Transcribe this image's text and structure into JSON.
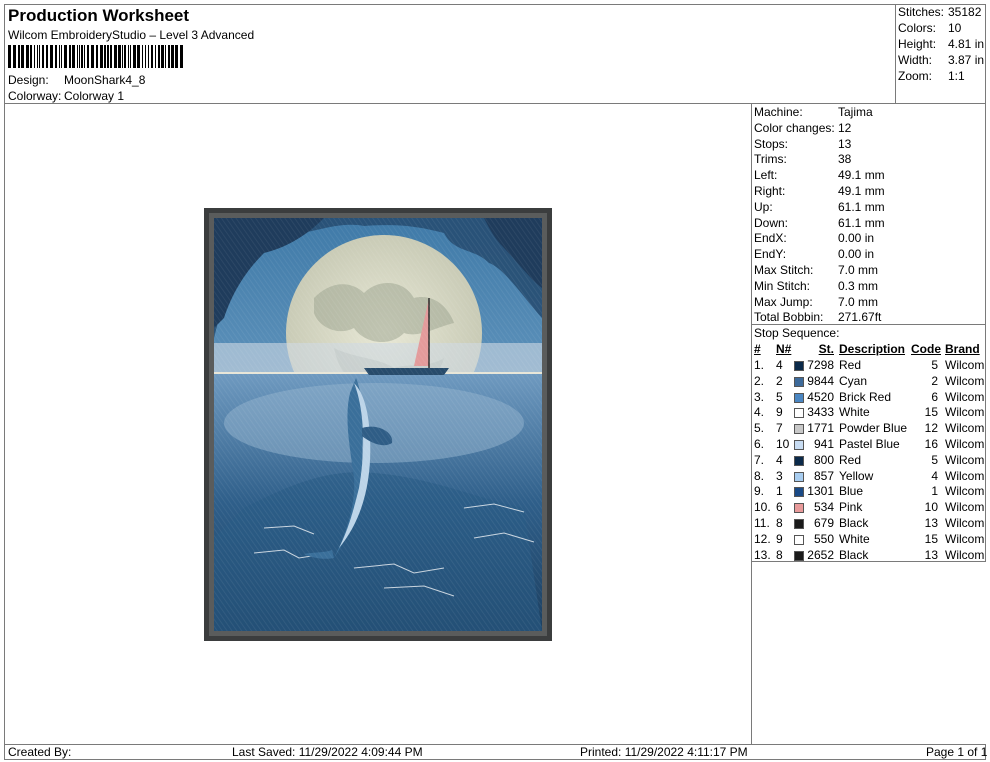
{
  "header": {
    "title": "Production Worksheet",
    "subtitle": "Wilcom EmbroideryStudio – Level 3 Advanced",
    "design_label": "Design:",
    "design_value": "MoonShark4_8",
    "colorway_label": "Colorway:",
    "colorway_value": "Colorway 1"
  },
  "summary": [
    {
      "label": "Stitches:",
      "value": "35182"
    },
    {
      "label": "Colors:",
      "value": "10"
    },
    {
      "label": "Height:",
      "value": "4.81 in"
    },
    {
      "label": "Width:",
      "value": "3.87 in"
    },
    {
      "label": "Zoom:",
      "value": "1:1"
    }
  ],
  "machine_info": [
    {
      "label": "Machine:",
      "value": "Tajima"
    },
    {
      "label": "Color changes:",
      "value": "12"
    },
    {
      "label": "Stops:",
      "value": "13"
    },
    {
      "label": "Trims:",
      "value": "38"
    },
    {
      "label": "Left:",
      "value": "49.1 mm"
    },
    {
      "label": "Right:",
      "value": "49.1 mm"
    },
    {
      "label": "Up:",
      "value": "61.1 mm"
    },
    {
      "label": "Down:",
      "value": "61.1 mm"
    },
    {
      "label": "EndX:",
      "value": "0.00 in"
    },
    {
      "label": "EndY:",
      "value": "0.00 in"
    },
    {
      "label": "Max Stitch:",
      "value": "7.0 mm"
    },
    {
      "label": "Min Stitch:",
      "value": "0.3 mm"
    },
    {
      "label": "Max Jump:",
      "value": "7.0 mm"
    },
    {
      "label": "Total Bobbin:",
      "value": "271.67ft"
    }
  ],
  "stop_sequence": {
    "label": "Stop Sequence:",
    "columns": {
      "num": "#",
      "n": "N#",
      "st": "St.",
      "desc": "Description",
      "code": "Code",
      "brand": "Brand"
    },
    "rows": [
      {
        "num": "1.",
        "n": "4",
        "color": "#0b2a4a",
        "st": "7298",
        "desc": "Red",
        "code": "5",
        "brand": "Wilcom"
      },
      {
        "num": "2.",
        "n": "2",
        "color": "#3d6a9a",
        "st": "9844",
        "desc": "Cyan",
        "code": "2",
        "brand": "Wilcom"
      },
      {
        "num": "3.",
        "n": "5",
        "color": "#4a86c2",
        "st": "4520",
        "desc": "Brick Red",
        "code": "6",
        "brand": "Wilcom"
      },
      {
        "num": "4.",
        "n": "9",
        "color": "#ffffff",
        "st": "3433",
        "desc": "White",
        "code": "15",
        "brand": "Wilcom"
      },
      {
        "num": "5.",
        "n": "7",
        "color": "#c8c8c8",
        "st": "1771",
        "desc": "Powder Blue",
        "code": "12",
        "brand": "Wilcom"
      },
      {
        "num": "6.",
        "n": "10",
        "color": "#c8dcf2",
        "st": "941",
        "desc": "Pastel Blue",
        "code": "16",
        "brand": "Wilcom"
      },
      {
        "num": "7.",
        "n": "4",
        "color": "#0b2a4a",
        "st": "800",
        "desc": "Red",
        "code": "5",
        "brand": "Wilcom"
      },
      {
        "num": "8.",
        "n": "3",
        "color": "#a8cdf0",
        "st": "857",
        "desc": "Yellow",
        "code": "4",
        "brand": "Wilcom"
      },
      {
        "num": "9.",
        "n": "1",
        "color": "#1a4a86",
        "st": "1301",
        "desc": "Blue",
        "code": "1",
        "brand": "Wilcom"
      },
      {
        "num": "10.",
        "n": "6",
        "color": "#e89a9a",
        "st": "534",
        "desc": "Pink",
        "code": "10",
        "brand": "Wilcom"
      },
      {
        "num": "11.",
        "n": "8",
        "color": "#1a1a1a",
        "st": "679",
        "desc": "Black",
        "code": "13",
        "brand": "Wilcom"
      },
      {
        "num": "12.",
        "n": "9",
        "color": "#ffffff",
        "st": "550",
        "desc": "White",
        "code": "15",
        "brand": "Wilcom"
      },
      {
        "num": "13.",
        "n": "8",
        "color": "#1a1a1a",
        "st": "2652",
        "desc": "Black",
        "code": "13",
        "brand": "Wilcom"
      }
    ]
  },
  "footer": {
    "created_by": "Created By:",
    "last_saved": "Last Saved: 11/29/2022 4:09:44 PM",
    "printed": "Printed: 11/29/2022 4:11:17 PM",
    "page": "Page 1 of 1"
  }
}
